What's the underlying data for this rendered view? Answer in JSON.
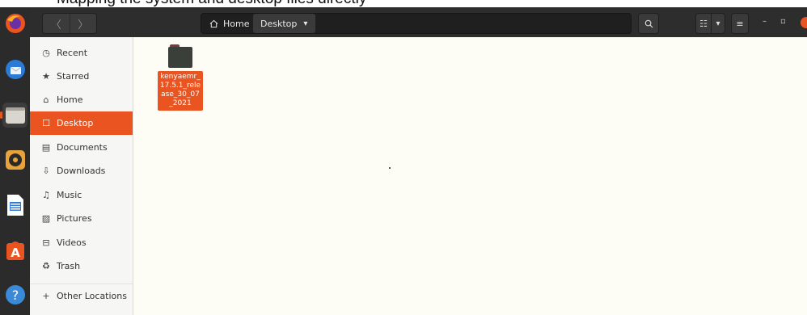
{
  "top_strip_text": "Mapping the system and desktop files directly",
  "dock": {
    "apps": [
      {
        "name": "firefox-icon"
      },
      {
        "name": "thunderbird-icon"
      },
      {
        "name": "files-icon",
        "active": true
      },
      {
        "name": "rhythmbox-icon"
      },
      {
        "name": "libreoffice-writer-icon"
      },
      {
        "name": "software-center-icon"
      },
      {
        "name": "help-icon"
      }
    ]
  },
  "header": {
    "back_glyph": "〈",
    "forward_glyph": "〉",
    "path": {
      "home_label": "Home",
      "current_label": "Desktop",
      "dropdown_glyph": "▾"
    },
    "search_glyph": "⌕",
    "view_list_glyph": "☷",
    "view_options_glyph": "▾",
    "menu_glyph": "≡",
    "minimize_glyph": "–",
    "maximize_glyph": "▫"
  },
  "sidebar": {
    "items": [
      {
        "label": "Recent",
        "icon": "clock-icon",
        "glyph": "◷"
      },
      {
        "label": "Starred",
        "icon": "star-icon",
        "glyph": "★"
      },
      {
        "label": "Home",
        "icon": "home-icon",
        "glyph": "⌂"
      },
      {
        "label": "Desktop",
        "icon": "desktop-icon",
        "glyph": "☐",
        "active": true
      },
      {
        "label": "Documents",
        "icon": "document-icon",
        "glyph": "▤"
      },
      {
        "label": "Downloads",
        "icon": "download-icon",
        "glyph": "⇩"
      },
      {
        "label": "Music",
        "icon": "music-icon",
        "glyph": "♫"
      },
      {
        "label": "Pictures",
        "icon": "picture-icon",
        "glyph": "▨"
      },
      {
        "label": "Videos",
        "icon": "video-icon",
        "glyph": "⊟"
      },
      {
        "label": "Trash",
        "icon": "trash-icon",
        "glyph": "♻"
      },
      {
        "label": "Other Locations",
        "icon": "plus-icon",
        "glyph": "+"
      }
    ]
  },
  "content": {
    "files": [
      {
        "name": "kenyaemr_17.5.1_release_30_07_2021",
        "type": "folder",
        "selected": true
      }
    ]
  },
  "colors": {
    "accent": "#e95420",
    "headerbar": "#2d2d2d",
    "dock": "#2b2b2b",
    "content_bg": "#fdfdf6"
  }
}
